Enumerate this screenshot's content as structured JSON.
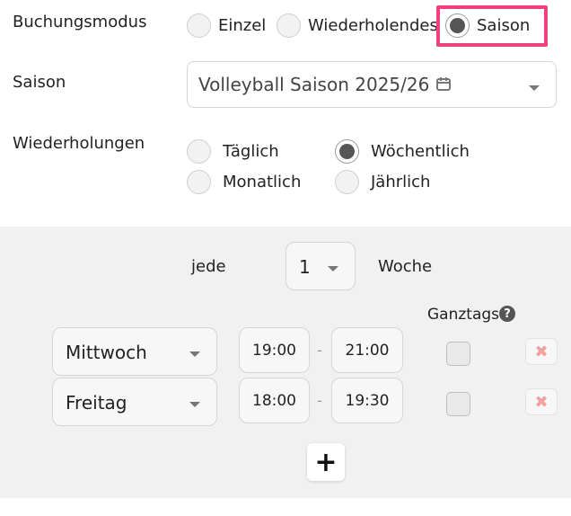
{
  "booking_mode": {
    "label": "Buchungsmodus",
    "options": [
      {
        "label": "Einzel",
        "checked": false
      },
      {
        "label": "Wiederholendes",
        "checked": false
      },
      {
        "label": "Saison",
        "checked": true
      }
    ]
  },
  "season": {
    "label": "Saison",
    "value": "Volleyball Saison 2025/26",
    "icon": "calendar-icon"
  },
  "repetitions": {
    "label": "Wiederholungen",
    "options": [
      {
        "label": "Täglich",
        "checked": false
      },
      {
        "label": "Wöchentlich",
        "checked": true
      },
      {
        "label": "Monatlich",
        "checked": false
      },
      {
        "label": "Jährlich",
        "checked": false
      }
    ]
  },
  "interval": {
    "prefix": "jede",
    "value": "1",
    "unit": "Woche"
  },
  "all_day_label": "Ganztags",
  "rows": [
    {
      "day": "Mittwoch",
      "start": "19:00",
      "sep": "-",
      "end": "21:00",
      "all_day": false
    },
    {
      "day": "Freitag",
      "start": "18:00",
      "sep": "-",
      "end": "19:30",
      "all_day": false
    }
  ],
  "add_button": "+",
  "remove_icon": "✖",
  "help_icon": "?"
}
